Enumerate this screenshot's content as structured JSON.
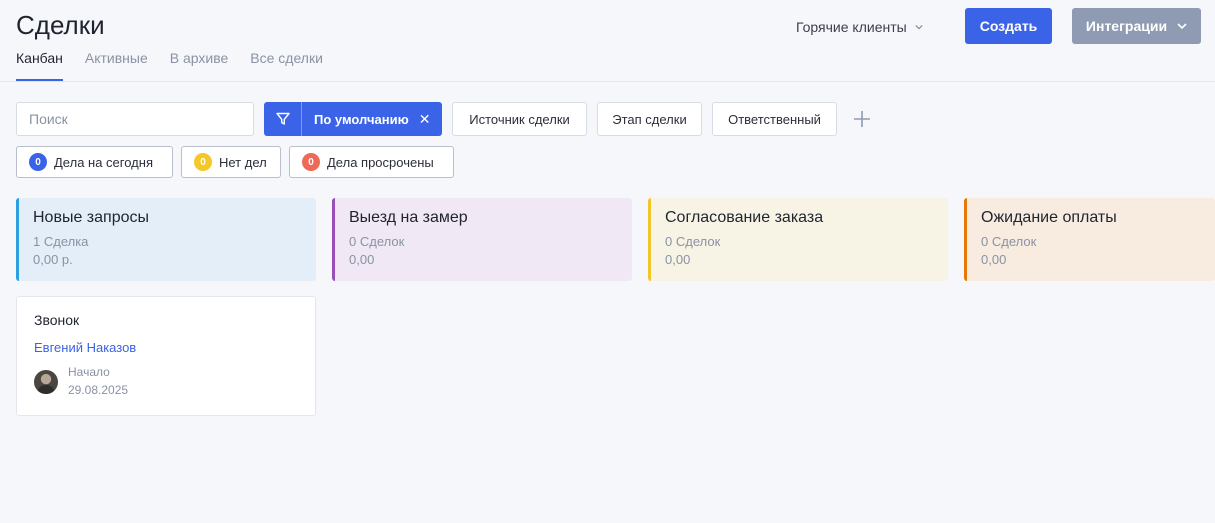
{
  "header": {
    "title": "Сделки",
    "tabs": [
      {
        "label": "Канбан",
        "active": true
      },
      {
        "label": "Активные"
      },
      {
        "label": "В архиве"
      },
      {
        "label": "Все сделки"
      }
    ],
    "hot_clients_label": "Горячие клиенты",
    "create_label": "Создать",
    "integrations_label": "Интеграции"
  },
  "filters": {
    "search_placeholder": "Поиск",
    "default_filter_label": "По умолчанию",
    "buttons": [
      "Источник сделки",
      "Этап сделки",
      "Ответственный"
    ]
  },
  "task_chips": [
    {
      "count": "0",
      "label": "Дела на сегодня",
      "color": "#3b63e8"
    },
    {
      "count": "0",
      "label": "Нет дел",
      "color": "#f5c828"
    },
    {
      "count": "0",
      "label": "Дела просрочены",
      "color": "#ee6a57"
    }
  ],
  "stages": [
    {
      "name": "Новые запросы",
      "count": "1 Сделка",
      "sum": "0,00 р.",
      "accent": "#2f9fe0",
      "bg": "#e3eef9"
    },
    {
      "name": "Выезд на замер",
      "count": "0 Сделок",
      "sum": "0,00",
      "accent": "#9b4fb8",
      "bg": "#f0e8f4"
    },
    {
      "name": "Согласование заказа",
      "count": "0 Сделок",
      "sum": "0,00",
      "accent": "#f2c52a",
      "bg": "#f7f4e6"
    },
    {
      "name": "Ожидание оплаты",
      "count": "0 Сделок",
      "sum": "0,00",
      "accent": "#e8780a",
      "bg": "#f8ebe0"
    }
  ],
  "deal_card": {
    "title": "Звонок",
    "contact": "Евгений Наказов",
    "date_label": "Начало",
    "date": "29.08.2025"
  }
}
